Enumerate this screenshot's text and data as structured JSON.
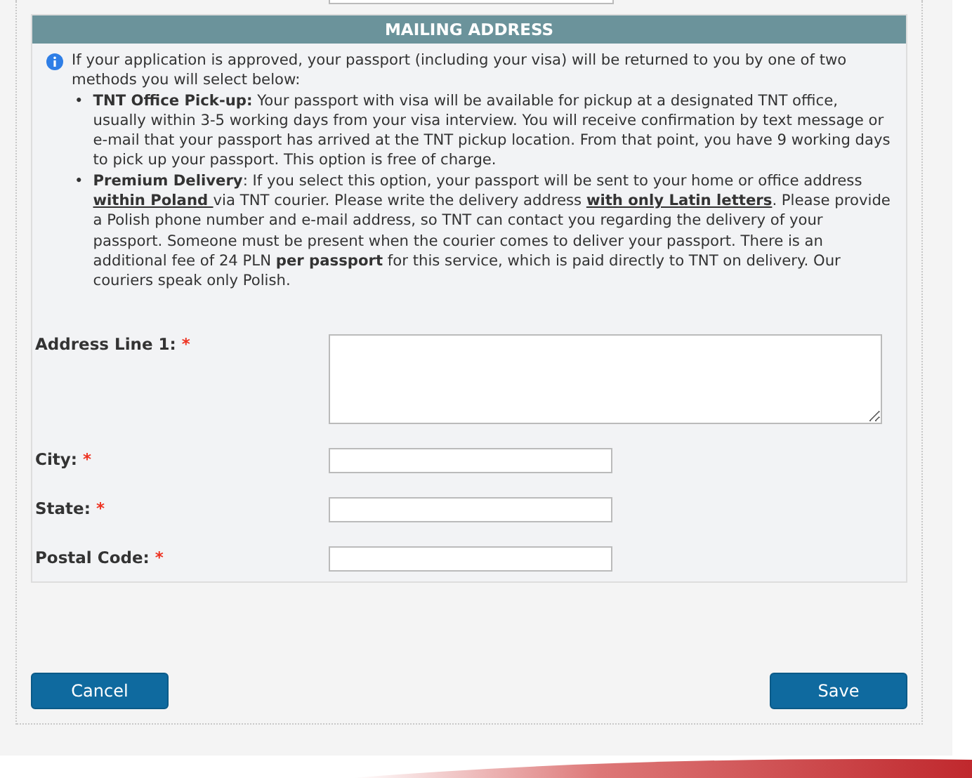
{
  "section": {
    "title": "MAILING ADDRESS"
  },
  "info": {
    "intro": "If your application is approved, your passport (including your visa) will be returned to you by one of two methods you will select below:",
    "bullets": [
      {
        "marker": "•",
        "segments": [
          {
            "text": "TNT Office Pick-up:",
            "bold": true,
            "underline": false
          },
          {
            "text": " Your passport with visa will be available for pickup at a designated TNT office, usually within 3-5 working days from your visa interview. You will receive confirmation by text message or e-mail that your passport has arrived at the TNT pickup location. From that point, you have 9 working days to pick up your passport. This option is free of charge.",
            "bold": false,
            "underline": false
          }
        ]
      },
      {
        "marker": "•",
        "segments": [
          {
            "text": "Premium Delivery",
            "bold": true,
            "underline": false
          },
          {
            "text": ":  If you select this option, your passport will be sent to your home or office address ",
            "bold": false,
            "underline": false
          },
          {
            "text": "within Poland ",
            "bold": true,
            "underline": true
          },
          {
            "text": "via TNT courier. Please write the delivery address ",
            "bold": false,
            "underline": false
          },
          {
            "text": "with only Latin letters",
            "bold": true,
            "underline": true
          },
          {
            "text": ". Please provide a Polish phone number and e-mail address, so TNT can contact you regarding the delivery of your passport. Someone must be present when the courier comes to deliver your passport. There is an additional fee of 24 PLN ",
            "bold": false,
            "underline": false
          },
          {
            "text": "per passport",
            "bold": true,
            "underline": false
          },
          {
            "text": " for this service, which is paid directly to TNT on delivery. Our couriers speak only Polish.",
            "bold": false,
            "underline": false
          }
        ]
      }
    ]
  },
  "fields": [
    {
      "label": "Address Line 1:",
      "required": "*",
      "kind": "textarea"
    },
    {
      "label": "City:",
      "required": "*",
      "kind": "text"
    },
    {
      "label": "State:",
      "required": "*",
      "kind": "text"
    },
    {
      "label": "Postal Code:",
      "required": "*",
      "kind": "text"
    }
  ],
  "buttons": [
    {
      "label": "Cancel"
    },
    {
      "label": "Save"
    }
  ]
}
